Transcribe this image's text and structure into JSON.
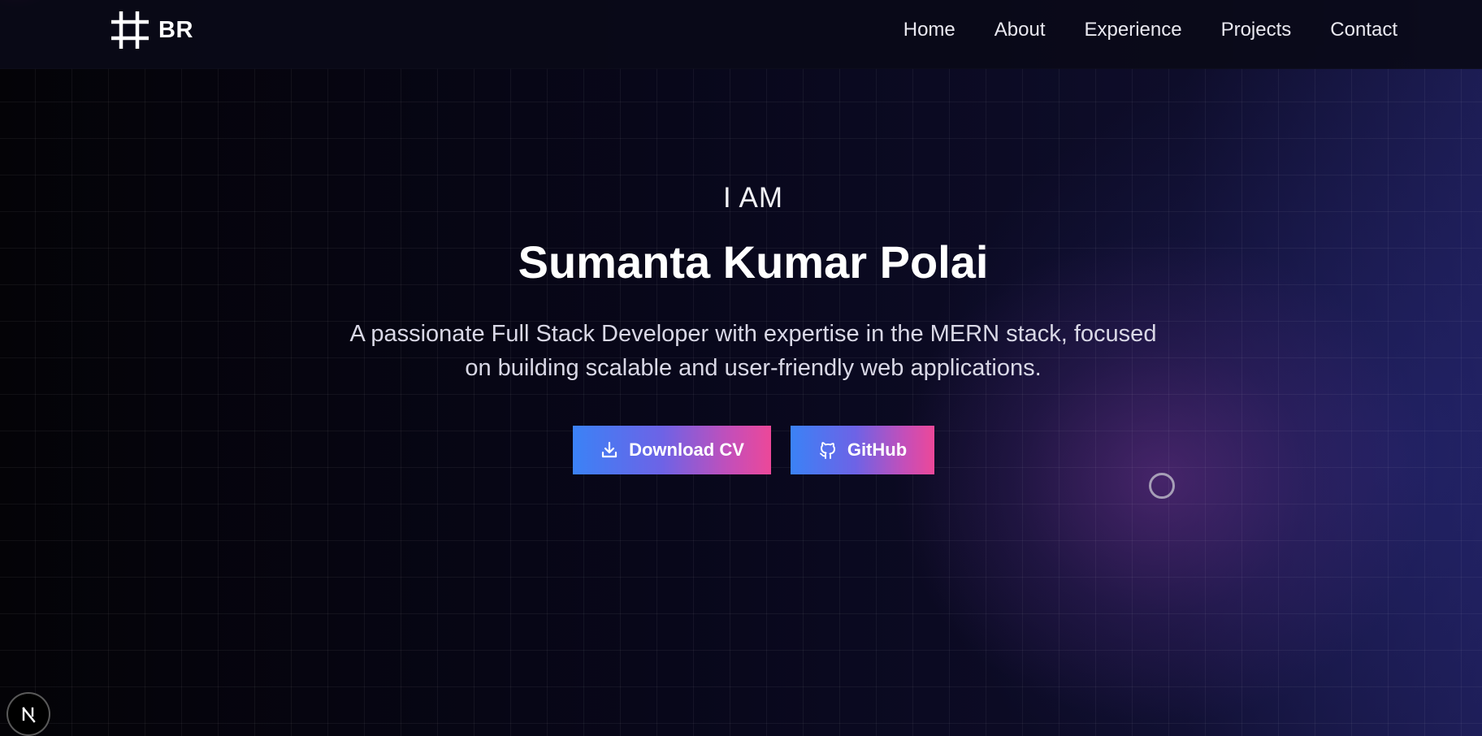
{
  "header": {
    "brand_text": "BR",
    "logo_icon": "hash-icon",
    "nav": [
      {
        "label": "Home"
      },
      {
        "label": "About"
      },
      {
        "label": "Experience"
      },
      {
        "label": "Projects"
      },
      {
        "label": "Contact"
      }
    ]
  },
  "hero": {
    "kicker": "I AM",
    "name": "Sumanta Kumar Polai",
    "description": "A passionate Full Stack Developer with expertise in the MERN stack, focused on building scalable and user-friendly web applications.",
    "buttons": {
      "download_cv": {
        "label": "Download CV",
        "icon": "download-icon"
      },
      "github": {
        "label": "GitHub",
        "icon": "github-icon"
      }
    }
  },
  "badge": {
    "icon": "nextjs-icon"
  },
  "colors": {
    "accent_start": "#3b82f6",
    "accent_end": "#ec4899",
    "background": "#08070f"
  }
}
